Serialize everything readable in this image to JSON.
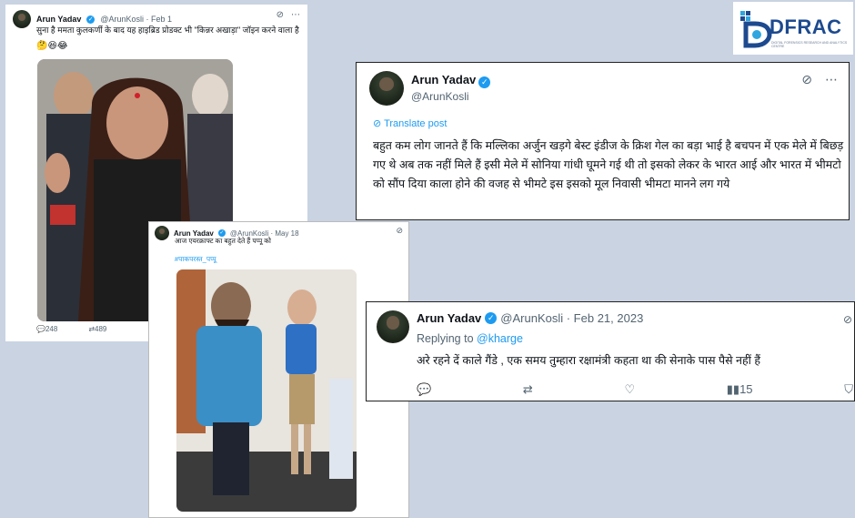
{
  "logo": {
    "brand": "DFRAC",
    "tagline": "DIGITAL FORENSICS RESEARCH AND ANALYTICS CENTRE",
    "colors": {
      "primary": "#1d4a8f",
      "accent": "#2fa6e0"
    }
  },
  "tweet_top_left": {
    "name": "Arun Yadav",
    "handle_date": "@ArunKosli · Feb 1",
    "text": "सुना है ममता कुलकर्णी के बाद यह हाइब्रिड प्रोडक्ट भी \"किन्नर अखाड़ा\" जॉइन करने वाला है",
    "emoji": "🤔😆😂",
    "replies": "248",
    "retweets": "489"
  },
  "tweet_large": {
    "name": "Arun Yadav",
    "handle": "@ArunKosli",
    "translate": "Translate post",
    "text": "बहुत कम लोग जानते हैं कि मल्लिका अर्जुन खड़गे बेस्ट इंडीज के क्रिश गेल का बड़ा भाई है बचपन में एक मेले में बिछड़ गए थे अब तक नहीं मिले हैं इसी मेले में सोनिया गांधी घूमने गई थी तो इसको लेकर के भारत आई और भारत में भीमटो को सौंप दिया काला होने की वजह से भीमटे इस इसको मूल निवासी भीमटा मानने लग गये"
  },
  "tweet_middle": {
    "name": "Arun Yadav",
    "handle_date": "@ArunKosli · May 18",
    "text": "आज एयरक्राफ्ट का बहुत देते हैं पप्पू को",
    "hashtag": "#पाकपरस्त_पप्पू"
  },
  "tweet_reply": {
    "name": "Arun Yadav",
    "handle_date": "@ArunKosli · Feb 21, 2023",
    "replying_prefix": "Replying to",
    "replying_to": "@kharge",
    "text": "अरे रहने दें काले गैंडे , एक समय तुम्हारा रक्षामंत्री कहता था की सेनाके पास पैसे नहीं हैं",
    "views": "15"
  },
  "icons": {
    "verified": "verified-check-icon",
    "grok": "grok-icon",
    "more": "more-options-icon",
    "reply": "reply-icon",
    "retweet": "retweet-icon",
    "like": "like-icon",
    "views": "views-icon",
    "bookmark": "bookmark-icon",
    "translate": "translate-icon"
  }
}
